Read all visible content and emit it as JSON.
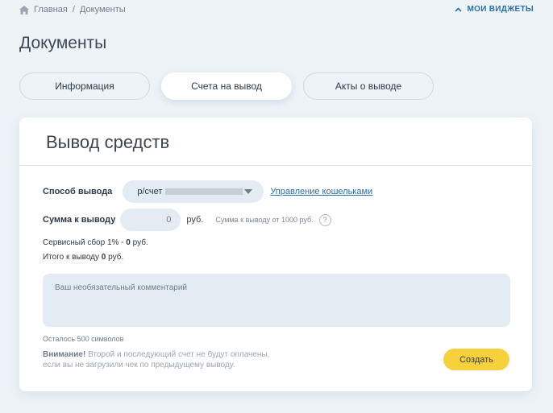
{
  "breadcrumb": {
    "home": "Главная",
    "separator": "/",
    "current": "Документы"
  },
  "widgets": {
    "label": "МОИ ВИДЖЕТЫ"
  },
  "page": {
    "title": "Документы"
  },
  "tabs": [
    {
      "label": "Информация"
    },
    {
      "label": "Счета на вывод"
    },
    {
      "label": "Акты о выводе"
    }
  ],
  "card": {
    "title": "Вывод средств",
    "method": {
      "label": "Способ вывода",
      "selected_prefix": "р/счет",
      "manage_link": "Управление кошельками"
    },
    "amount": {
      "label": "Сумма к выводу",
      "value": "0",
      "currency": "руб.",
      "min_note": "Сумма к выводу от 1000 руб.",
      "help": "?"
    },
    "fee": {
      "prefix": "Сервисный сбор 1% - ",
      "value": "0",
      "suffix": " руб."
    },
    "total": {
      "prefix": "Итого к выводу ",
      "value": "0",
      "suffix": " руб."
    },
    "comment": {
      "placeholder": "Ваш необязательный комментарий"
    },
    "remaining": "Осталось 500 символов",
    "warning": {
      "label": "Внимание!",
      "text": " Второй и последующий счет не будут оплачены, если вы не загрузили чек по предыдущему выводу."
    },
    "submit": "Создать"
  },
  "colors": {
    "accent": "#2a6fa8",
    "button": "#f7d13c",
    "background": "#eef3f8"
  }
}
